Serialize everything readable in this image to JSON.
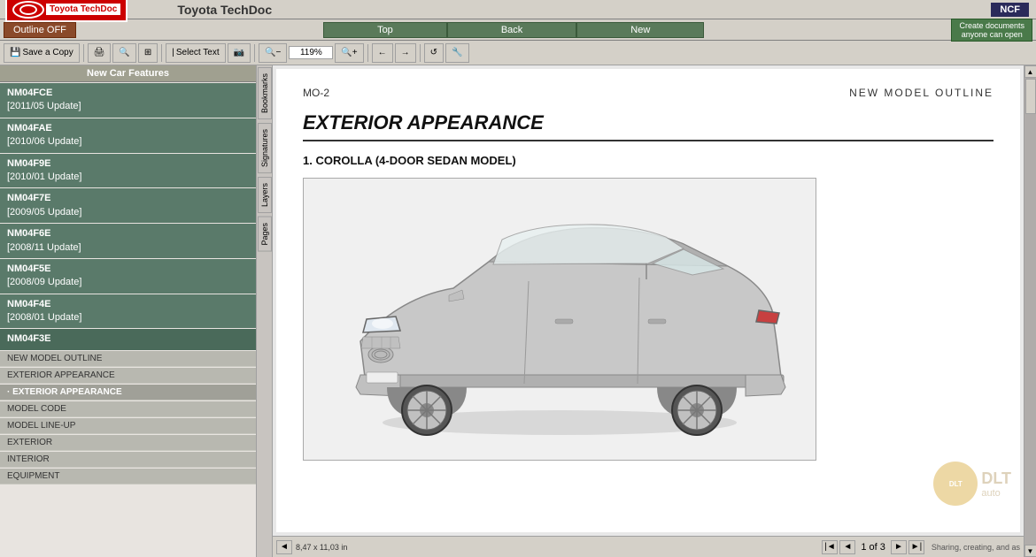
{
  "app": {
    "title": "Toyota TechDoc",
    "badge": "NCF",
    "outline_btn": "Outline OFF"
  },
  "nav": {
    "top_btn": "Top",
    "back_btn": "Back",
    "new_btn": "New",
    "create_docs": "Create documents\nanyone can open"
  },
  "toolbar": {
    "save_copy": "Save a Copy",
    "select_text": "Select Text",
    "zoom_level": "119%"
  },
  "sidebar": {
    "header": "New Car Features",
    "items": [
      {
        "id": "NM04FCE",
        "label": "NM04FCE",
        "update": "[2011/05 Update]"
      },
      {
        "id": "NM04FAE",
        "label": "NM04FAE",
        "update": "[2010/06 Update]"
      },
      {
        "id": "NM04F9E",
        "label": "NM04F9E",
        "update": "[2010/01 Update]"
      },
      {
        "id": "NM04F7E",
        "label": "NM04F7E",
        "update": "[2009/05 Update]"
      },
      {
        "id": "NM04F6E",
        "label": "NM04F6E",
        "update": "[2008/11 Update]"
      },
      {
        "id": "NM04F5E",
        "label": "NM04F5E",
        "update": "[2008/09 Update]"
      },
      {
        "id": "NM04F4E",
        "label": "NM04F4E",
        "update": "[2008/01 Update]"
      },
      {
        "id": "NM04F3E",
        "label": "NM04F3E",
        "update": ""
      }
    ],
    "sub_items": [
      {
        "label": "NEW MODEL OUTLINE",
        "active": false,
        "bold": false
      },
      {
        "label": "EXTERIOR APPEARANCE",
        "active": false,
        "bold": false
      },
      {
        "label": "· EXTERIOR APPEARANCE",
        "active": true,
        "bold": true
      },
      {
        "label": "MODEL CODE",
        "active": false,
        "bold": false
      },
      {
        "label": "MODEL LINE-UP",
        "active": false,
        "bold": false
      },
      {
        "label": "EXTERIOR",
        "active": false,
        "bold": false
      },
      {
        "label": "INTERIOR",
        "active": false,
        "bold": false
      },
      {
        "label": "EQUIPMENT",
        "active": false,
        "bold": false
      }
    ]
  },
  "side_tabs": [
    "Bookmarks",
    "Signatures",
    "Layers",
    "Pages"
  ],
  "doc": {
    "page_ref": "MO-2",
    "section": "NEW MODEL OUTLINE",
    "main_title": "EXTERIOR APPEARANCE",
    "subsection": "1.  COROLLA (4-DOOR SEDAN MODEL)"
  },
  "status": {
    "dimensions": "8,47 x 11,03 in",
    "page_current": "1",
    "page_total": "3",
    "page_label": "of"
  }
}
